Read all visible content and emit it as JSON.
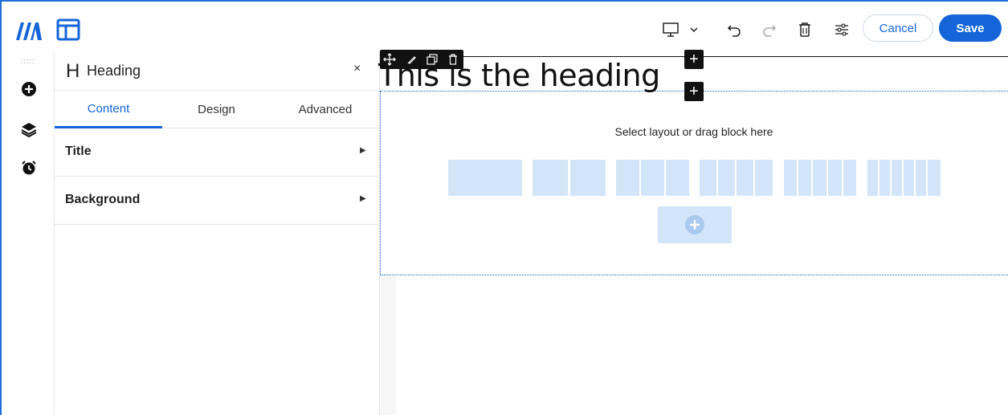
{
  "topbar": {
    "logo_icon": "brand-logo-icon",
    "layout_icon": "layout-icon",
    "device_icon": "desktop-icon",
    "undo_icon": "undo-icon",
    "redo_icon": "redo-icon",
    "delete_icon": "trash-icon",
    "settings_icon": "sliders-icon",
    "cancel_label": "Cancel",
    "save_label": "Save"
  },
  "rail": {
    "items": [
      {
        "icon": "add-circle-icon"
      },
      {
        "icon": "layers-icon"
      },
      {
        "icon": "alarm-icon"
      }
    ]
  },
  "panel": {
    "glyph": "H",
    "title": "Heading",
    "close": "×",
    "tabs": [
      {
        "label": "Content",
        "active": true
      },
      {
        "label": "Design",
        "active": false
      },
      {
        "label": "Advanced",
        "active": false
      }
    ],
    "sections": [
      {
        "label": "Title"
      },
      {
        "label": "Background"
      }
    ]
  },
  "canvas": {
    "heading_text": "This is the heading",
    "block_hint": "Select layout or drag block here",
    "plus_symbol": "+",
    "mini_toolbar_icons": [
      "move-icon",
      "edit-icon",
      "duplicate-icon",
      "trash-icon"
    ]
  },
  "colors": {
    "accent": "#1565d8",
    "layout_placeholder": "#d3e5f9"
  }
}
